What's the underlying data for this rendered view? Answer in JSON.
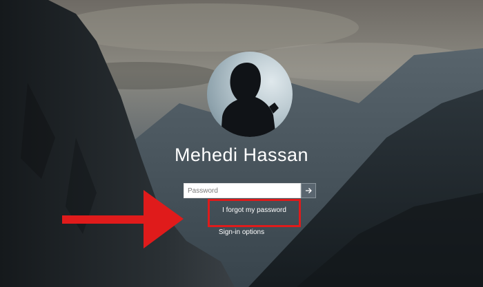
{
  "lock_screen": {
    "user_name": "Mehedi Hassan",
    "password_placeholder": "Password",
    "forgot_password_label": "I forgot my password",
    "signin_options_label": "Sign-in options"
  },
  "icons": {
    "submit": "arrow-right-icon",
    "annotation": "red-arrow-annotation"
  },
  "colors": {
    "annotation_red": "#e01b1b",
    "submit_button": "#5a6670",
    "text": "#ffffff"
  }
}
